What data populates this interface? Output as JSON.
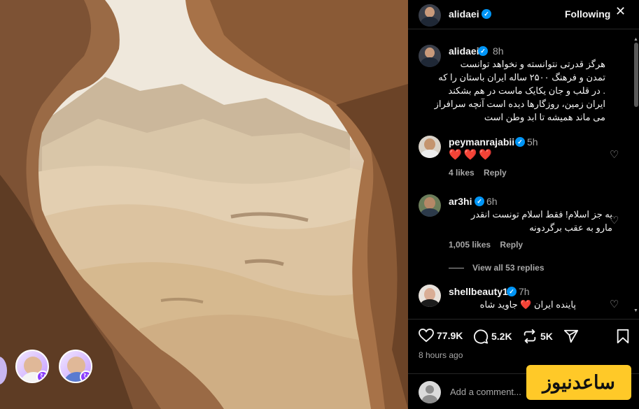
{
  "post": {
    "author": "alidaei",
    "follow_state": "Following",
    "caption_author": "alidaei",
    "caption_time": "8h",
    "caption_lines": [
      "هرگز قدرتی نتوانسته و نخواهد توانست",
      "تمدن و فرهنگ ۲۵۰۰ ساله ایران باستان را که",
      ". در قلب و جان یکایک ماست در هم بشکند",
      "ایران زمین، روزگارها دیده است آنچه سرافراز",
      "می ماند همیشه تا ابد وطن است"
    ]
  },
  "comments": [
    {
      "user": "peymanrajabii",
      "time": "5h",
      "text": "❤️❤️❤️",
      "likes": "4 likes",
      "reply": "Reply"
    },
    {
      "user": "ar3hi",
      "time": "6h",
      "lines": [
        "به جز اسلام! فقط اسلام تونست انقدر",
        "مارو به عقب برگردونه"
      ],
      "likes": "1,005 likes",
      "reply": "Reply"
    },
    {
      "user": "shellbeauty1",
      "time": "7h",
      "text": "پاینده ایران ❤️ جاوید شاه"
    }
  ],
  "view_replies": "View all 53 replies",
  "stats": {
    "likes": "77.9K",
    "comments": "5.2K",
    "reposts": "5K"
  },
  "posted_ago": "8 hours ago",
  "add_comment_placeholder": "Add a comment...",
  "watermark": "ساعدنیوز",
  "icons": [
    "verified-badge-icon",
    "more-options-icon",
    "heart-icon",
    "comment-icon",
    "repost-icon",
    "share-icon",
    "bookmark-icon",
    "repost-badge-icon"
  ],
  "colors": {
    "verified": "#0095f6",
    "like_red": "#ff3040",
    "repost_badge": "#8b3dff",
    "watermark_bg": "#ffc928"
  }
}
